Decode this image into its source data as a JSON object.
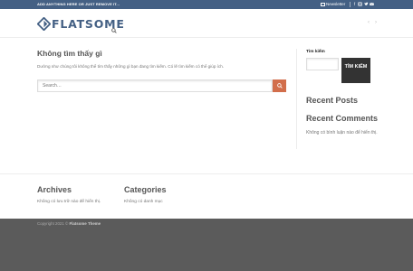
{
  "topbar": {
    "promo": "ADD ANYTHING HERE OR JUST REMOVE IT...",
    "newsletter": "Newsletter",
    "social_icons": [
      "facebook-icon",
      "instagram-icon",
      "twitter-icon",
      "email-icon"
    ]
  },
  "header": {
    "logo_text": "FLATSOME"
  },
  "main": {
    "title": "Không tìm thấy gì",
    "message": "Dường như chúng tôi không thể tìm thấy những gì bạn đang tìm kiếm. Có lẽ tìm kiếm có thể giúp ích.",
    "search_placeholder": "Search…"
  },
  "sidebar": {
    "search_label": "Tìm kiếm",
    "search_button": "TÌM KIẾM",
    "recent_posts_title": "Recent Posts",
    "recent_comments_title": "Recent Comments",
    "no_comments": "Không có bình luận nào để hiển thị."
  },
  "footer": {
    "archives_title": "Archives",
    "archives_text": "Không có lưu trữ nào để hiển thị.",
    "categories_title": "Categories",
    "categories_text": "Không có danh mục",
    "copyright_prefix": "Copyright 2021 ©",
    "copyright_brand": "Flatsome Theme"
  },
  "colors": {
    "topbar": "#446084",
    "accent": "#d26e4b",
    "footer_dark": "#5b5b5b"
  }
}
